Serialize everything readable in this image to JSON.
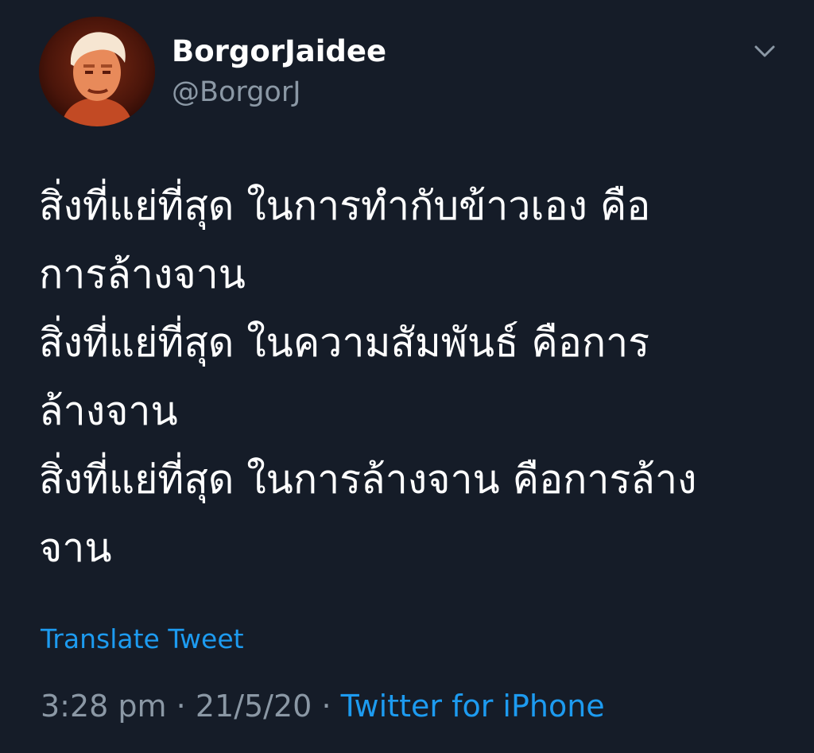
{
  "theme": {
    "background": "#151c28",
    "text_primary": "#ffffff",
    "text_secondary": "#8b98a5",
    "link": "#1d9bf0"
  },
  "author": {
    "display_name": "BorgorJaidee",
    "handle": "@BorgorJ",
    "avatar_icon": "avatar-portrait-icon"
  },
  "menu": {
    "icon": "chevron-down-icon"
  },
  "tweet": {
    "lines": [
      "สิ่งที่แย่ที่สุด ในการทำกับข้าวเอง คือ",
      "การล้างจาน",
      "สิ่งที่แย่ที่สุด ในความสัมพันธ์ คือการ",
      "ล้างจาน",
      "สิ่งที่แย่ที่สุด ในการล้างจาน คือการล้าง",
      "จาน"
    ]
  },
  "translate_label": "Translate Tweet",
  "meta": {
    "time": "3:28 pm",
    "separator": "·",
    "date": "21/5/20",
    "source": "Twitter for iPhone"
  }
}
